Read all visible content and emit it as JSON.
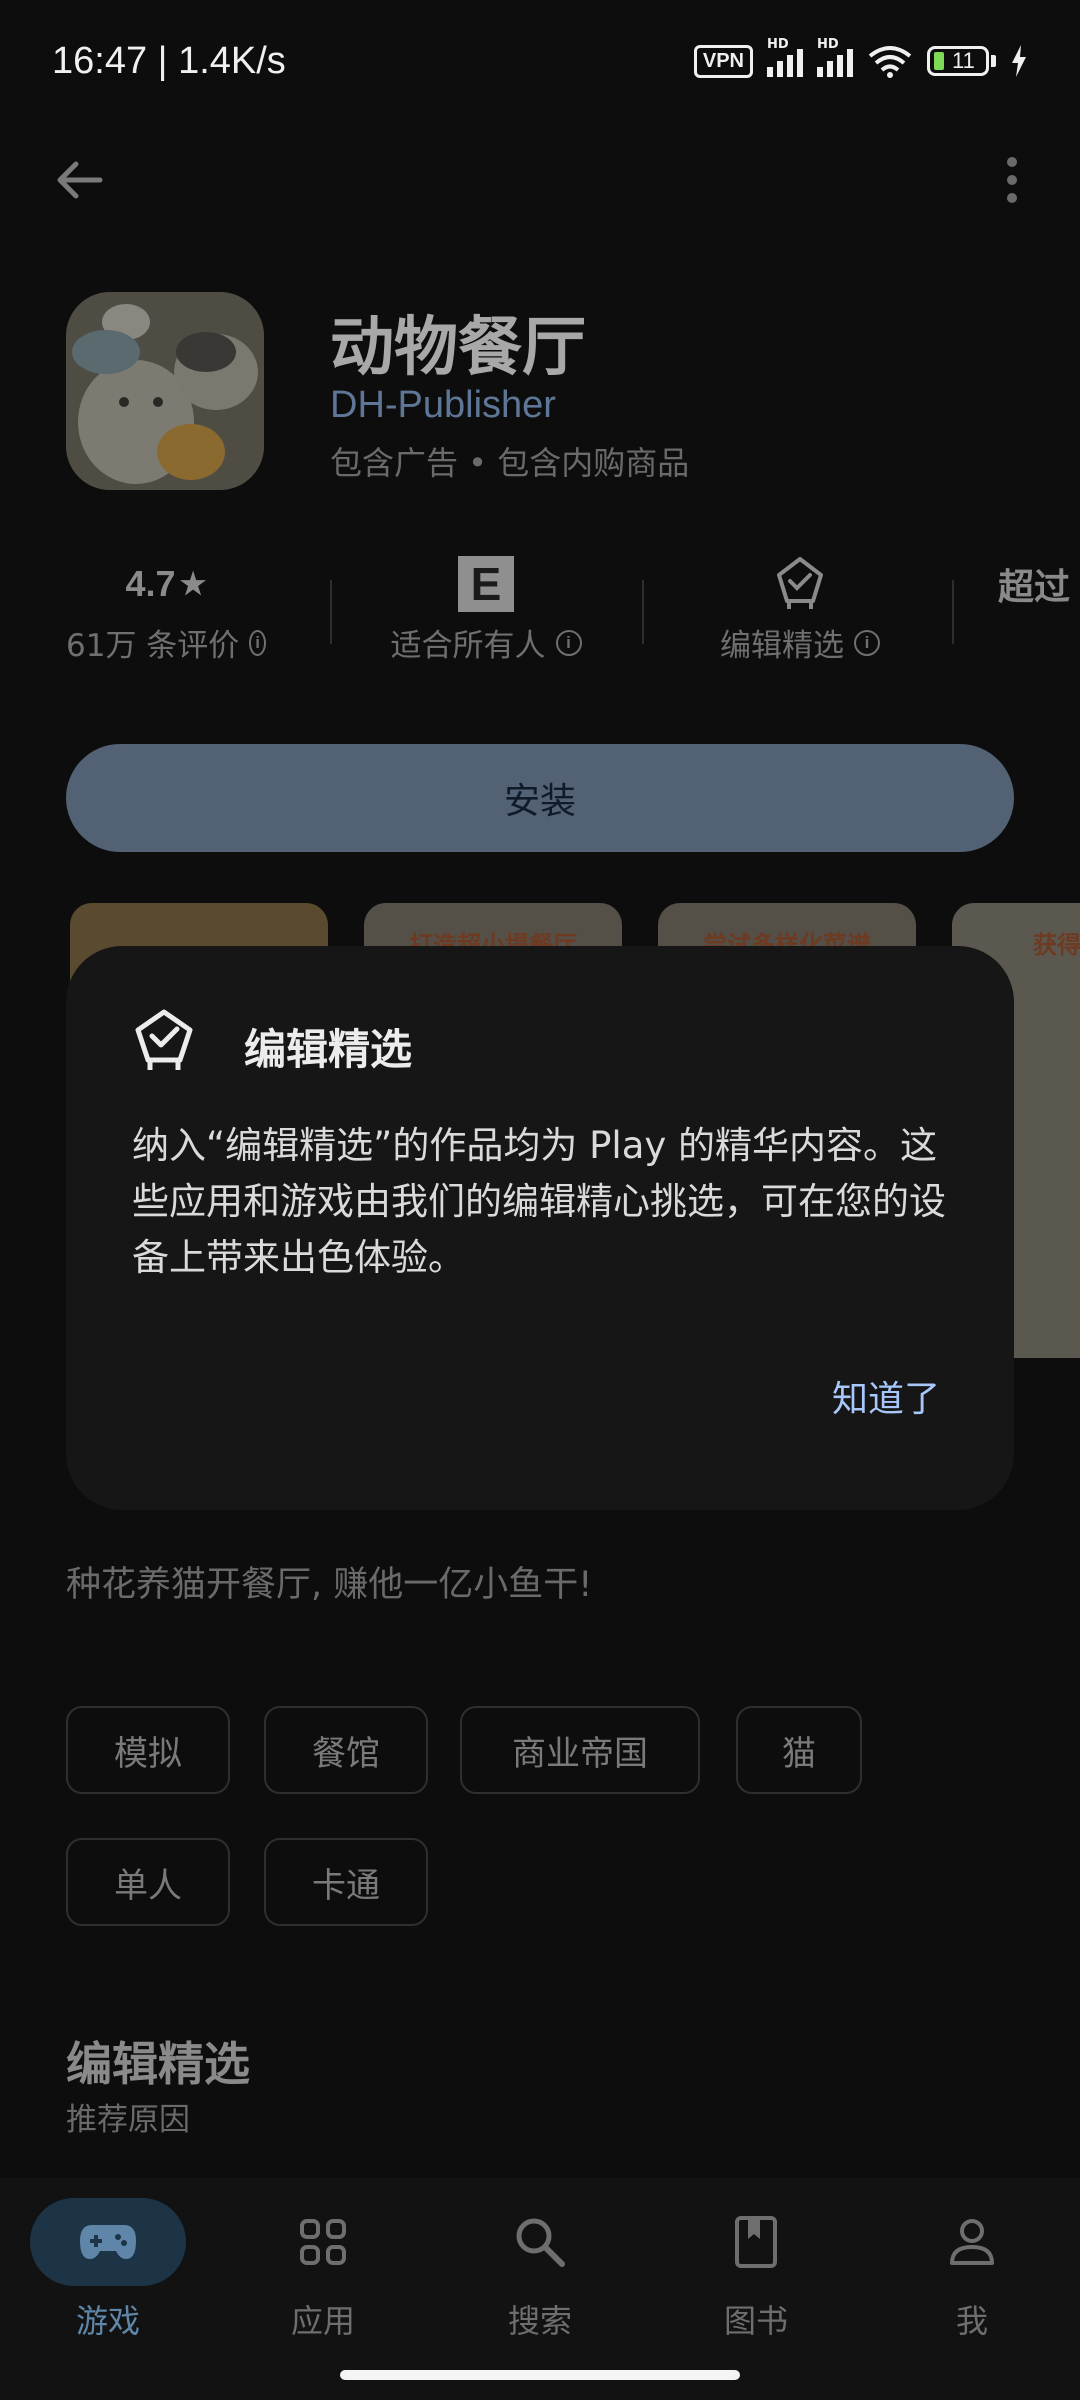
{
  "status_bar": {
    "time": "16:47 | 1.4K/s",
    "vpn": "VPN",
    "hd1": "HD",
    "hd2": "HD",
    "battery": "11"
  },
  "app": {
    "title": "动物餐厅",
    "publisher": "DH-Publisher",
    "meta": "包含广告 • 包含内购商品"
  },
  "stats": {
    "rating": "4.7",
    "rating_star": "★",
    "reviews": "61万 条评价",
    "content_rating_badge": "E",
    "content_rating": "适合所有人",
    "editors_choice": "编辑精选",
    "downloads_partial": "超过"
  },
  "install_label": "安装",
  "screenshot_captions": [
    "",
    "打造超小堤餐厅",
    "尝试多样化菜谱",
    "获得全方"
  ],
  "tagline": "种花养猫开餐厅, 赚他一亿小鱼干!",
  "chips": [
    "模拟",
    "餐馆",
    "商业帝国",
    "猫",
    "单人",
    "卡通"
  ],
  "section": {
    "title": "编辑精选",
    "subtitle": "推荐原因"
  },
  "dialog": {
    "title": "编辑精选",
    "body": "纳入“编辑精选”的作品均为 Play 的精华内容。这些应用和游戏由我们的编辑精心挑选，可在您的设备上带来出色体验。",
    "confirm": "知道了"
  },
  "nav": {
    "items": [
      {
        "label": "游戏",
        "icon": "gamepad-icon",
        "active": true
      },
      {
        "label": "应用",
        "icon": "apps-grid-icon",
        "active": false
      },
      {
        "label": "搜索",
        "icon": "search-icon",
        "active": false
      },
      {
        "label": "图书",
        "icon": "book-icon",
        "active": false
      },
      {
        "label": "我",
        "icon": "person-icon",
        "active": false
      }
    ]
  },
  "colors": {
    "accent": "#a8c7fa",
    "install_bg": "#536174",
    "nav_active": "#5f86a8"
  }
}
